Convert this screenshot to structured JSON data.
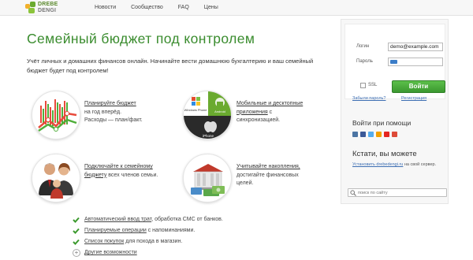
{
  "header": {
    "logo_line1": "DREBE",
    "logo_line2": "DENGI",
    "nav": [
      "Новости",
      "Сообщество",
      "FAQ",
      "Цены"
    ]
  },
  "hero": {
    "title": "Семейный бюджет под контролем",
    "description": "Учёт личных и домашних финансов онлайн. Начинайте вести домашнюю бухгалтерию и ваш семейный бюджет будет под контролем!"
  },
  "features": [
    {
      "link": "Планируйте бюджет",
      "line2": "на год вперёд.",
      "line3": "Расходы — план/факт.",
      "icon": "chart-icon"
    },
    {
      "link1": "Мобильные и десктопные",
      "link2": "приложения",
      "line2_rest": " с",
      "line3": "синхронизацией.",
      "icon": "mobile-apps-icon",
      "platforms": [
        "Windows Phone",
        "Android",
        "iPhone"
      ]
    },
    {
      "link1": "Подключайте к семейному",
      "link2": "бюджету",
      "line2_rest": " всех членов семьи.",
      "icon": "family-icon"
    },
    {
      "link": "Учитывайте накопления,",
      "line2": "достигайте финансовых",
      "line3": "целей.",
      "icon": "savings-icon"
    }
  ],
  "checklist": [
    {
      "link": "Автоматический ввод трат",
      "rest": ", обработка СМС от банков."
    },
    {
      "link": "Планируемые операции",
      "rest": " с напоминаниями."
    },
    {
      "link": "Список покупок",
      "rest": " для похода в магазин."
    },
    {
      "link": "Другие возможности",
      "rest": ""
    }
  ],
  "login": {
    "login_label": "Логин",
    "login_value": "demo@example.com",
    "password_label": "Пароль",
    "ssl_label": "SSL",
    "submit_label": "Войти",
    "forgot_link": "Забыли пароль?",
    "register_link": "Регистрация"
  },
  "help": {
    "heading": "Войти при помощи",
    "providers": [
      "vk",
      "facebook",
      "twitter",
      "mailru",
      "yandex",
      "google"
    ]
  },
  "extension": {
    "heading": "Кстати, вы можете",
    "link": "Установить drebedengi.ru",
    "text_rest": " на свой сервер."
  },
  "search": {
    "placeholder": "поиск по сайту"
  },
  "colors": {
    "accent_green": "#3a8c2e",
    "link_blue": "#3e6fb3"
  }
}
